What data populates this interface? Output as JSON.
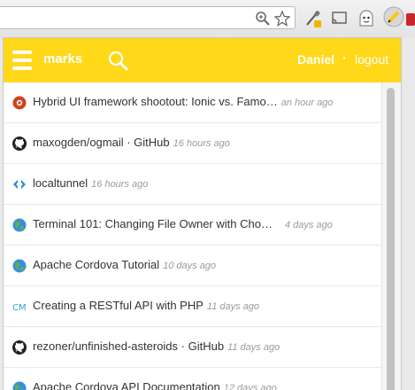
{
  "header": {
    "brand": "marks",
    "user": "Daniel",
    "separator": "·",
    "logout": "logout",
    "accent": "#ffd81a"
  },
  "bookmarks": [
    {
      "icon": "ionic-logo-icon",
      "title": "Hybrid UI framework shootout: Ionic vs. Famo…",
      "time": "an hour ago"
    },
    {
      "icon": "github-icon",
      "title": "maxogden/ogmail · GitHub",
      "time": "16 hours ago"
    },
    {
      "icon": "localtunnel-icon",
      "title": "localtunnel",
      "time": "16 hours ago"
    },
    {
      "icon": "globe-icon",
      "title": "Terminal 101: Changing File Owner with Cho…",
      "time": "4 days ago"
    },
    {
      "icon": "globe-icon",
      "title": "Apache Cordova Tutorial",
      "time": "10 days ago"
    },
    {
      "icon": "cm-icon",
      "title": "Creating a RESTful API with PHP",
      "time": "11 days ago"
    },
    {
      "icon": "github-icon",
      "title": "rezoner/unfinished-asteroids · GitHub",
      "time": "11 days ago"
    },
    {
      "icon": "globe-icon",
      "title": "Apache Cordova API Documentation",
      "time": "12 days ago"
    }
  ]
}
